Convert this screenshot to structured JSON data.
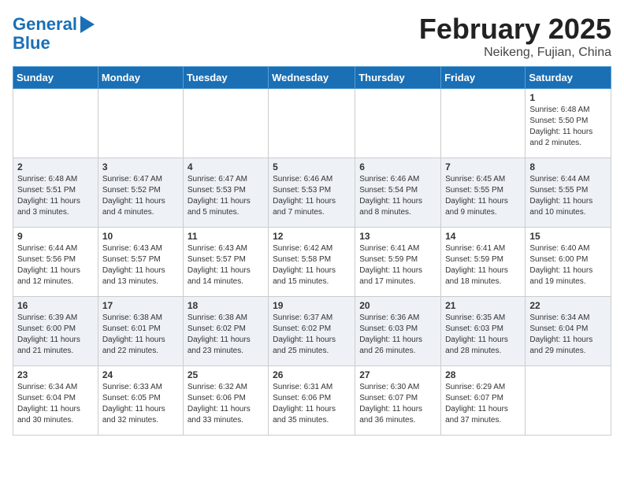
{
  "header": {
    "logo_line1": "General",
    "logo_line2": "Blue",
    "month": "February 2025",
    "location": "Neikeng, Fujian, China"
  },
  "weekdays": [
    "Sunday",
    "Monday",
    "Tuesday",
    "Wednesday",
    "Thursday",
    "Friday",
    "Saturday"
  ],
  "weeks": [
    [
      {
        "day": "",
        "info": ""
      },
      {
        "day": "",
        "info": ""
      },
      {
        "day": "",
        "info": ""
      },
      {
        "day": "",
        "info": ""
      },
      {
        "day": "",
        "info": ""
      },
      {
        "day": "",
        "info": ""
      },
      {
        "day": "1",
        "info": "Sunrise: 6:48 AM\nSunset: 5:50 PM\nDaylight: 11 hours and 2 minutes."
      }
    ],
    [
      {
        "day": "2",
        "info": "Sunrise: 6:48 AM\nSunset: 5:51 PM\nDaylight: 11 hours and 3 minutes."
      },
      {
        "day": "3",
        "info": "Sunrise: 6:47 AM\nSunset: 5:52 PM\nDaylight: 11 hours and 4 minutes."
      },
      {
        "day": "4",
        "info": "Sunrise: 6:47 AM\nSunset: 5:53 PM\nDaylight: 11 hours and 5 minutes."
      },
      {
        "day": "5",
        "info": "Sunrise: 6:46 AM\nSunset: 5:53 PM\nDaylight: 11 hours and 7 minutes."
      },
      {
        "day": "6",
        "info": "Sunrise: 6:46 AM\nSunset: 5:54 PM\nDaylight: 11 hours and 8 minutes."
      },
      {
        "day": "7",
        "info": "Sunrise: 6:45 AM\nSunset: 5:55 PM\nDaylight: 11 hours and 9 minutes."
      },
      {
        "day": "8",
        "info": "Sunrise: 6:44 AM\nSunset: 5:55 PM\nDaylight: 11 hours and 10 minutes."
      }
    ],
    [
      {
        "day": "9",
        "info": "Sunrise: 6:44 AM\nSunset: 5:56 PM\nDaylight: 11 hours and 12 minutes."
      },
      {
        "day": "10",
        "info": "Sunrise: 6:43 AM\nSunset: 5:57 PM\nDaylight: 11 hours and 13 minutes."
      },
      {
        "day": "11",
        "info": "Sunrise: 6:43 AM\nSunset: 5:57 PM\nDaylight: 11 hours and 14 minutes."
      },
      {
        "day": "12",
        "info": "Sunrise: 6:42 AM\nSunset: 5:58 PM\nDaylight: 11 hours and 15 minutes."
      },
      {
        "day": "13",
        "info": "Sunrise: 6:41 AM\nSunset: 5:59 PM\nDaylight: 11 hours and 17 minutes."
      },
      {
        "day": "14",
        "info": "Sunrise: 6:41 AM\nSunset: 5:59 PM\nDaylight: 11 hours and 18 minutes."
      },
      {
        "day": "15",
        "info": "Sunrise: 6:40 AM\nSunset: 6:00 PM\nDaylight: 11 hours and 19 minutes."
      }
    ],
    [
      {
        "day": "16",
        "info": "Sunrise: 6:39 AM\nSunset: 6:00 PM\nDaylight: 11 hours and 21 minutes."
      },
      {
        "day": "17",
        "info": "Sunrise: 6:38 AM\nSunset: 6:01 PM\nDaylight: 11 hours and 22 minutes."
      },
      {
        "day": "18",
        "info": "Sunrise: 6:38 AM\nSunset: 6:02 PM\nDaylight: 11 hours and 23 minutes."
      },
      {
        "day": "19",
        "info": "Sunrise: 6:37 AM\nSunset: 6:02 PM\nDaylight: 11 hours and 25 minutes."
      },
      {
        "day": "20",
        "info": "Sunrise: 6:36 AM\nSunset: 6:03 PM\nDaylight: 11 hours and 26 minutes."
      },
      {
        "day": "21",
        "info": "Sunrise: 6:35 AM\nSunset: 6:03 PM\nDaylight: 11 hours and 28 minutes."
      },
      {
        "day": "22",
        "info": "Sunrise: 6:34 AM\nSunset: 6:04 PM\nDaylight: 11 hours and 29 minutes."
      }
    ],
    [
      {
        "day": "23",
        "info": "Sunrise: 6:34 AM\nSunset: 6:04 PM\nDaylight: 11 hours and 30 minutes."
      },
      {
        "day": "24",
        "info": "Sunrise: 6:33 AM\nSunset: 6:05 PM\nDaylight: 11 hours and 32 minutes."
      },
      {
        "day": "25",
        "info": "Sunrise: 6:32 AM\nSunset: 6:06 PM\nDaylight: 11 hours and 33 minutes."
      },
      {
        "day": "26",
        "info": "Sunrise: 6:31 AM\nSunset: 6:06 PM\nDaylight: 11 hours and 35 minutes."
      },
      {
        "day": "27",
        "info": "Sunrise: 6:30 AM\nSunset: 6:07 PM\nDaylight: 11 hours and 36 minutes."
      },
      {
        "day": "28",
        "info": "Sunrise: 6:29 AM\nSunset: 6:07 PM\nDaylight: 11 hours and 37 minutes."
      },
      {
        "day": "",
        "info": ""
      }
    ]
  ]
}
